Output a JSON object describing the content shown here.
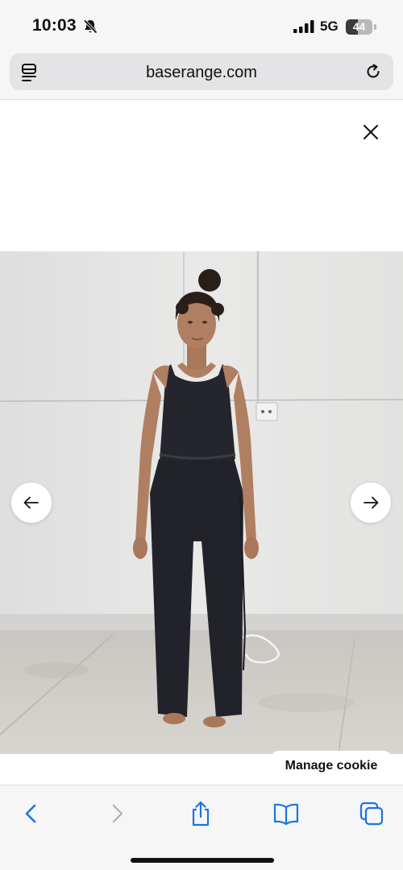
{
  "status_bar": {
    "time": "10:03",
    "network": "5G",
    "battery_level": "44",
    "battery_fraction": 0.44,
    "icons": [
      "bell-muted-icon",
      "signal-icon",
      "battery-icon"
    ]
  },
  "browser": {
    "url": "baserange.com",
    "icons": [
      "reader-icon",
      "reload-icon"
    ]
  },
  "page": {
    "close_icon": "close-icon",
    "prev_icon": "arrow-left-icon",
    "next_icon": "arrow-right-icon",
    "cookie_label": "Manage cookie"
  },
  "toolbar": {
    "icons": [
      "back-icon",
      "forward-icon",
      "share-icon",
      "bookmarks-icon",
      "tabs-icon"
    ],
    "accent": "#1a73e8",
    "disabled": "#b0b0b4"
  }
}
